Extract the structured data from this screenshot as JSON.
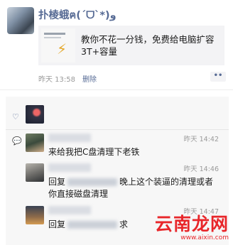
{
  "post": {
    "author_name": "扑棱蛾ฅ(ˊᗜˋ*)و",
    "link_card": {
      "title": "教你不花一分钱，免费给电脑扩容3T+容量",
      "thumb_icon": "lightning-icon"
    },
    "time": "昨天 13:58",
    "delete_label": "删除",
    "more_label": "••"
  },
  "interactions": {
    "like_icon": "heart-icon",
    "comment_icon": "comment-icon",
    "comments": [
      {
        "time": "昨天 14:42",
        "text": "来给我把C盘清理下老铁"
      },
      {
        "time": "昨天 14:46",
        "prefix": "回复",
        "text": "晚上这个装逼的清理或者你直接磁盘清理"
      },
      {
        "time": "昨天 14:47",
        "prefix": "回复",
        "text": "求"
      }
    ]
  },
  "watermark": {
    "text": "云南龙网",
    "url": "www.aixin.com",
    "color": "#e8262a"
  },
  "colors": {
    "link_blue": "#576b95",
    "meta_gray": "#9a9a9a",
    "panel_bg": "#f7f7f7"
  }
}
